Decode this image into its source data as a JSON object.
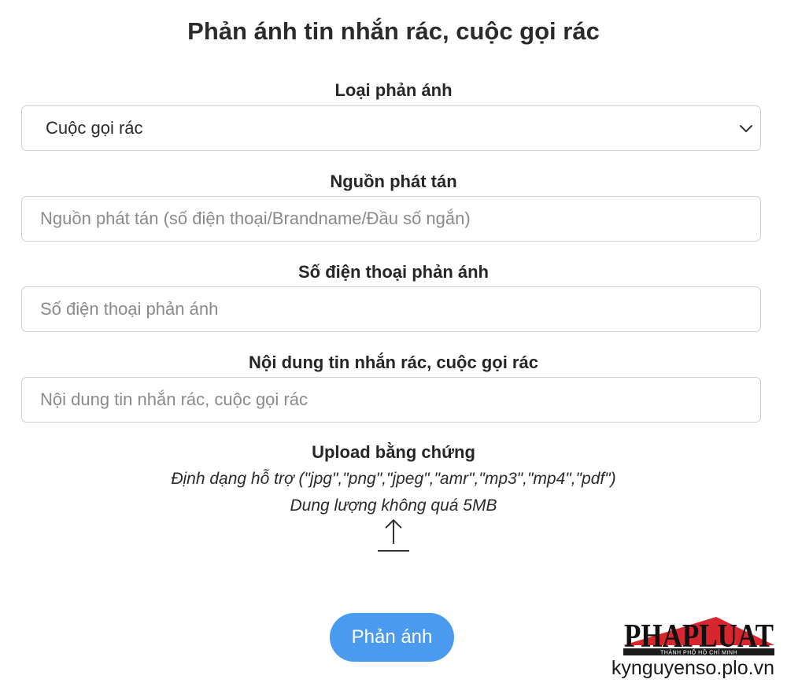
{
  "page": {
    "title": "Phản ánh tin nhắn rác, cuộc gọi rác"
  },
  "form": {
    "report_type": {
      "label": "Loại phản ánh",
      "selected": "Cuộc gọi rác"
    },
    "source": {
      "label": "Nguồn phát tán",
      "placeholder": "Nguồn phát tán (số điện thoại/Brandname/Đầu số ngắn)",
      "value": ""
    },
    "reporter_phone": {
      "label": "Số điện thoại phản ánh",
      "placeholder": "Số điện thoại phản ánh",
      "value": ""
    },
    "content": {
      "label": "Nội dung tin nhắn rác, cuộc gọi rác",
      "placeholder": "Nội dung tin nhắn rác, cuộc gọi rác",
      "value": ""
    },
    "upload": {
      "title": "Upload bằng chứng",
      "formats_note": "Định dạng hỗ trợ (\"jpg\",\"png\",\"jpeg\",\"amr\",\"mp3\",\"mp4\",\"pdf\")",
      "size_note": "Dung lượng không quá 5MB",
      "icon": "upload-arrow-icon"
    },
    "submit_label": "Phản ánh"
  },
  "branding": {
    "logo_text": "PHAPLUAT",
    "logo_subtext": "THÀNH PHỐ HỒ CHÍ MINH",
    "url": "kynguyenso.plo.vn"
  },
  "colors": {
    "button": "#4a9bef",
    "logo_accent": "#d8262e",
    "border": "#cfcfcf"
  }
}
